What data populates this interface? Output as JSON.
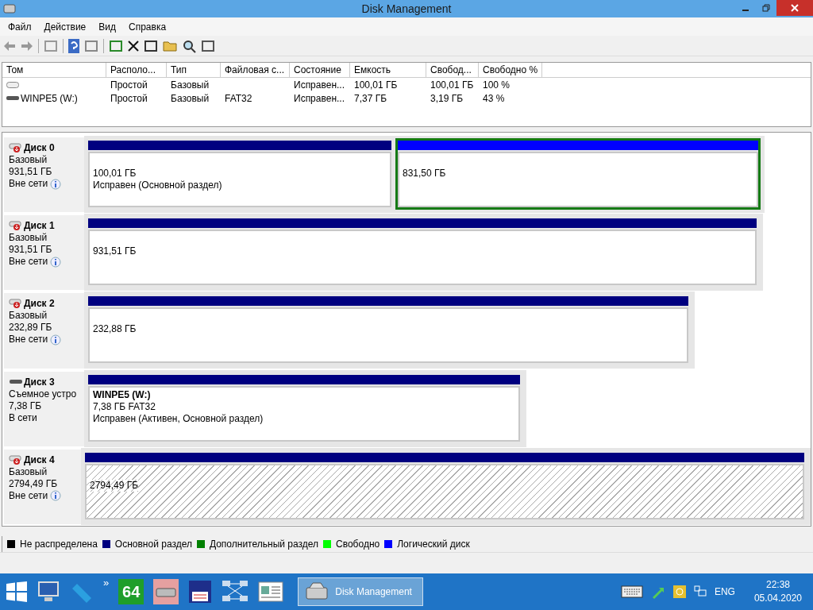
{
  "window": {
    "title": "Disk Management"
  },
  "menu": [
    "Файл",
    "Действие",
    "Вид",
    "Справка"
  ],
  "table": {
    "columns": [
      "Том",
      "Располо...",
      "Тип",
      "Файловая с...",
      "Состояние",
      "Емкость",
      "Свобод...",
      "Свободно %"
    ],
    "rows": [
      {
        "kind": "volume",
        "cells": [
          "",
          "Простой",
          "Базовый",
          "",
          "Исправен...",
          "100,01 ГБ",
          "100,01 ГБ",
          "100 %"
        ]
      },
      {
        "kind": "drive",
        "cells": [
          "WINPE5 (W:)",
          "Простой",
          "Базовый",
          "FAT32",
          "Исправен...",
          "7,37 ГБ",
          "3,19 ГБ",
          "43 %"
        ]
      }
    ]
  },
  "disks": [
    {
      "kind": "hdd",
      "name": "Диск 0",
      "type": "Базовый",
      "size": "931,51 ГБ",
      "status": "Вне сети",
      "info": true,
      "partitions": [
        {
          "color": "#000080",
          "hatched": false,
          "selected": false,
          "size": "100,01 ГБ",
          "state": "Исправен (Основной раздел)"
        },
        {
          "color": "#0000ff",
          "hatched": false,
          "selected": true,
          "size": "831,50 ГБ"
        }
      ]
    },
    {
      "kind": "hdd",
      "name": "Диск 1",
      "type": "Базовый",
      "size": "931,51 ГБ",
      "status": "Вне сети",
      "info": true,
      "partitions": [
        {
          "color": "#000080",
          "hatched": false,
          "selected": false,
          "size": "931,51 ГБ"
        }
      ]
    },
    {
      "kind": "hdd",
      "name": "Диск 2",
      "type": "Базовый",
      "size": "232,89 ГБ",
      "status": "Вне сети",
      "info": true,
      "partitions": [
        {
          "color": "#000080",
          "hatched": false,
          "selected": false,
          "size": "232,88 ГБ"
        }
      ]
    },
    {
      "kind": "removable",
      "name": "Диск 3",
      "type": "Съемное устро",
      "size": "7,38 ГБ",
      "status": "В сети",
      "info": false,
      "partitions": [
        {
          "color": "#000080",
          "hatched": false,
          "selected": false,
          "label": "WINPE5  (W:)",
          "size": "7,38 ГБ FAT32",
          "state": "Исправен (Активен, Основной раздел)"
        }
      ]
    },
    {
      "kind": "hdd",
      "name": "Диск 4",
      "type": "Базовый",
      "size": "2794,49 ГБ",
      "status": "Вне сети",
      "info": true,
      "partitions": [
        {
          "color": "#000080",
          "hatched": true,
          "selected": false,
          "size": "2794,49 ГБ"
        }
      ]
    }
  ],
  "legend": [
    {
      "color": "#000000",
      "label": "Не распределена"
    },
    {
      "color": "#000080",
      "label": "Основной раздел"
    },
    {
      "color": "#008000",
      "label": "Дополнительный раздел"
    },
    {
      "color": "#00ff00",
      "label": "Свободно"
    },
    {
      "color": "#0000ff",
      "label": "Логический диск"
    }
  ],
  "taskbar": {
    "more": "»",
    "pinned": [
      "64"
    ],
    "app": {
      "label": "Disk Management",
      "selected": true
    },
    "language": "ENG",
    "time": "22:38",
    "date": "05.04.2020"
  }
}
